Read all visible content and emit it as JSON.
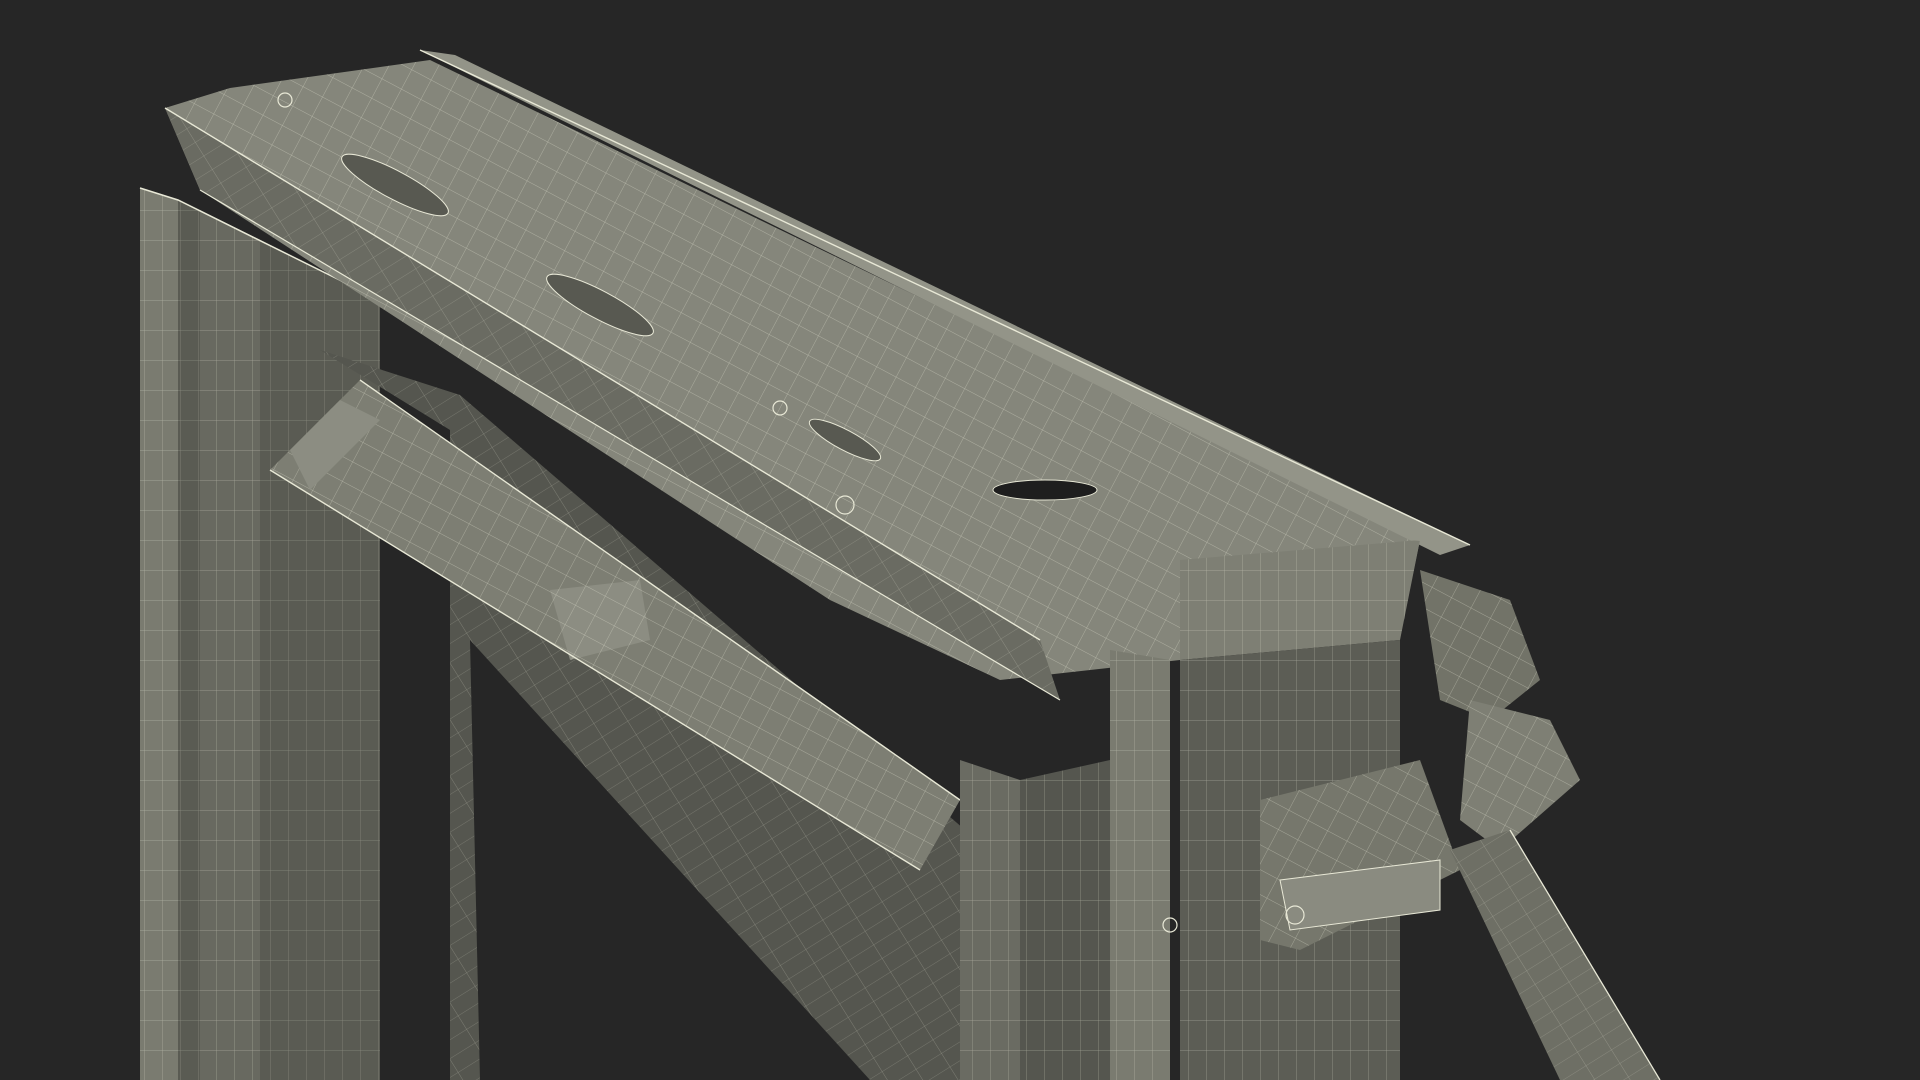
{
  "viewport": {
    "background": "#262626",
    "surface_color": "#6b6c62",
    "surface_light": "#8a8b80",
    "surface_dark": "#4f5049",
    "wire_color": "#e8e8d6"
  }
}
